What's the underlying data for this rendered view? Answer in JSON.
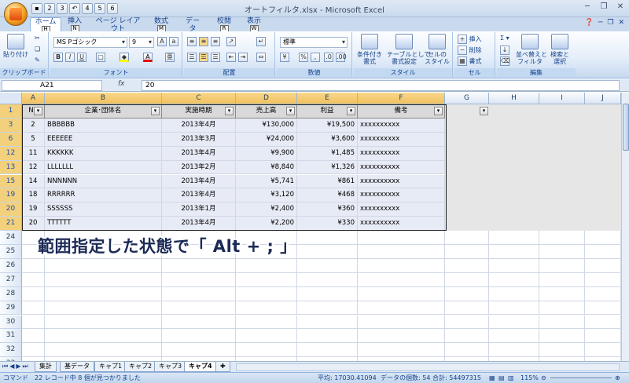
{
  "window": {
    "title": "オートフィルタ.xlsx - Microsoft Excel"
  },
  "qat": [
    "1",
    "2",
    "3",
    "4",
    "5",
    "6"
  ],
  "tabs": [
    {
      "label": "ホーム",
      "key": "H"
    },
    {
      "label": "挿入",
      "key": "N"
    },
    {
      "label": "ページ レイアウト",
      "key": "P"
    },
    {
      "label": "数式",
      "key": "M"
    },
    {
      "label": "データ",
      "key": "A"
    },
    {
      "label": "校閲",
      "key": "R"
    },
    {
      "label": "表示",
      "key": "W"
    }
  ],
  "ribbon": {
    "clipboard": {
      "label": "クリップボード",
      "paste": "貼り付け"
    },
    "font": {
      "label": "フォント",
      "name": "MS Pゴシック",
      "size": "9"
    },
    "alignment": {
      "label": "配置"
    },
    "number": {
      "label": "数値",
      "format": "標準"
    },
    "style": {
      "label": "スタイル",
      "cond": "条件付き\n書式",
      "table": "テーブルとして\n書式設定",
      "cell": "セルの\nスタイル"
    },
    "cells": {
      "label": "セル",
      "insert": "挿入",
      "delete": "削除",
      "format": "書式"
    },
    "edit": {
      "label": "編集",
      "sort": "並べ替えと\nフィルタ",
      "find": "検索と\n選択"
    }
  },
  "formula": {
    "name_box": "A21",
    "fx": "fx",
    "content": "20"
  },
  "columns": [
    "A",
    "B",
    "C",
    "D",
    "E",
    "F",
    "G",
    "H",
    "I",
    "J"
  ],
  "table": {
    "headers": [
      "No",
      "企業･団体名",
      "実施時期",
      "売上高",
      "利益",
      "備考"
    ],
    "rows": [
      {
        "row": "3",
        "no": "2",
        "name": "BBBBBB",
        "date": "2013年4月",
        "sales": "¥130,000",
        "profit": "¥19,500",
        "note": "xxxxxxxxxx"
      },
      {
        "row": "6",
        "no": "5",
        "name": "EEEEEE",
        "date": "2013年3月",
        "sales": "¥24,000",
        "profit": "¥3,600",
        "note": "xxxxxxxxxx"
      },
      {
        "row": "12",
        "no": "11",
        "name": "KKKKKK",
        "date": "2013年4月",
        "sales": "¥9,900",
        "profit": "¥1,485",
        "note": "xxxxxxxxxx"
      },
      {
        "row": "13",
        "no": "12",
        "name": "LLLLLLL",
        "date": "2013年2月",
        "sales": "¥8,840",
        "profit": "¥1,326",
        "note": "xxxxxxxxxx"
      },
      {
        "row": "15",
        "no": "14",
        "name": "NNNNNN",
        "date": "2013年4月",
        "sales": "¥5,741",
        "profit": "¥861",
        "note": "xxxxxxxxxx"
      },
      {
        "row": "19",
        "no": "18",
        "name": "RRRRRR",
        "date": "2013年4月",
        "sales": "¥3,120",
        "profit": "¥468",
        "note": "xxxxxxxxxx"
      },
      {
        "row": "20",
        "no": "19",
        "name": "SSSSSS",
        "date": "2013年1月",
        "sales": "¥2,400",
        "profit": "¥360",
        "note": "xxxxxxxxxx"
      },
      {
        "row": "21",
        "no": "20",
        "name": "TTTTTT",
        "date": "2013年4月",
        "sales": "¥2,200",
        "profit": "¥330",
        "note": "xxxxxxxxxx"
      }
    ]
  },
  "empty_rows": [
    "24",
    "25",
    "26",
    "27",
    "28",
    "29",
    "30",
    "31",
    "32",
    "33"
  ],
  "caption": "範囲指定した状態で「 Alt + ; 」",
  "sheets": [
    "集計",
    "基データ",
    "キャプ1",
    "キャプ2",
    "キャプ3",
    "キャプ4"
  ],
  "active_sheet": "キャプ4",
  "status": {
    "mode": "コマンド",
    "message": "22 レコード中 8 個が見つかりました",
    "average": "平均: 17030.41094",
    "count": "データの個数: 54",
    "sum": "合計: 54497315",
    "zoom": "115%"
  }
}
